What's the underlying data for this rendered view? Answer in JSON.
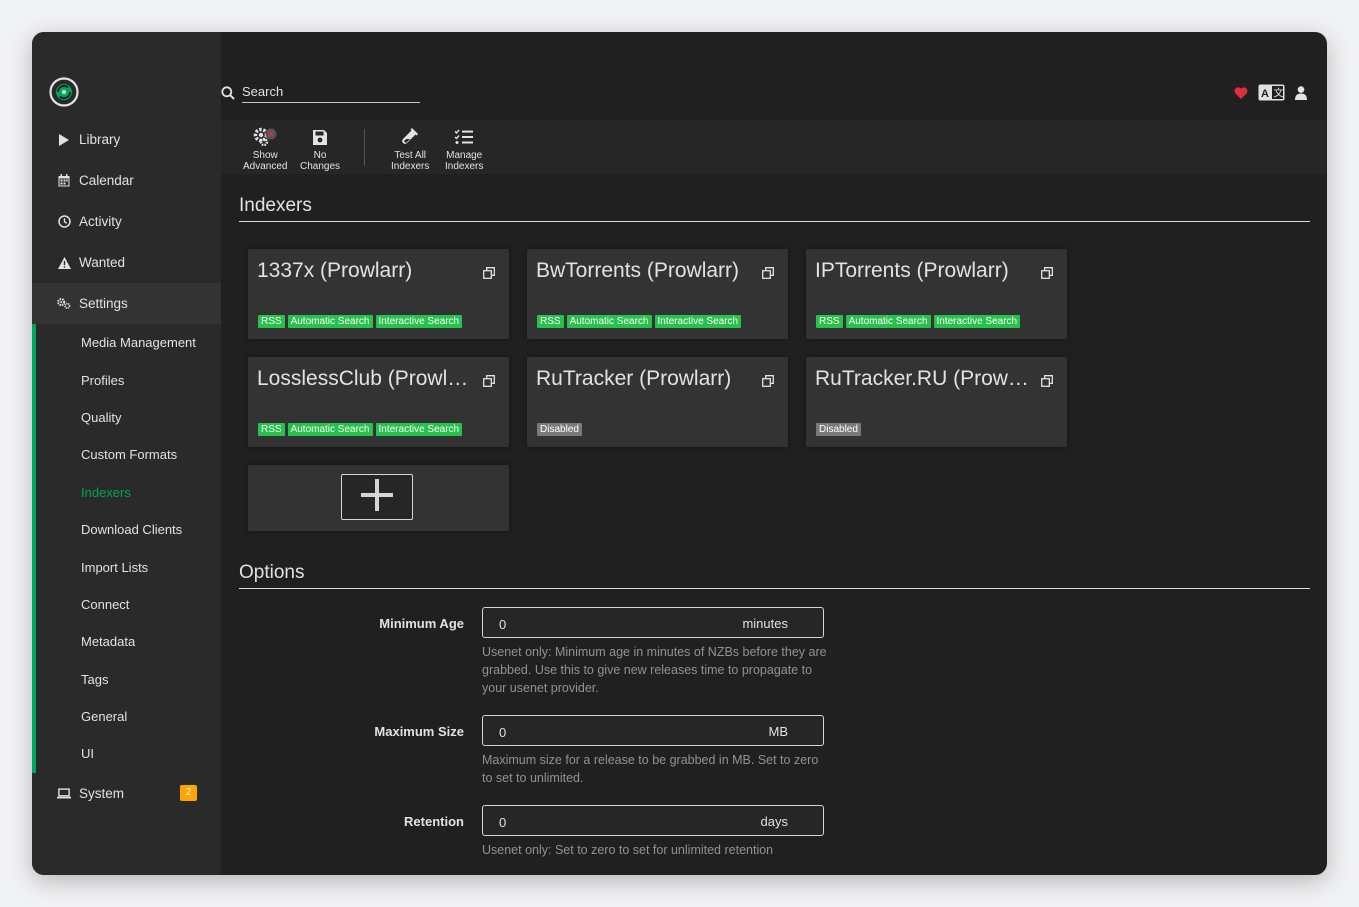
{
  "colors": {
    "accent": "#00a65b",
    "label_green": "#27c24c",
    "label_disabled": "#7a7a7a",
    "badge": "#ffa500",
    "heart": "#e22e3a"
  },
  "header": {
    "search_placeholder": "Search"
  },
  "sidebar": {
    "items": [
      {
        "label": "Library",
        "icon": "play-icon"
      },
      {
        "label": "Calendar",
        "icon": "calendar-icon"
      },
      {
        "label": "Activity",
        "icon": "clock-icon"
      },
      {
        "label": "Wanted",
        "icon": "warning-icon"
      },
      {
        "label": "Settings",
        "icon": "cogs-icon"
      },
      {
        "label": "System",
        "icon": "laptop-icon",
        "badge": "2"
      }
    ],
    "settings_items": [
      "Media Management",
      "Profiles",
      "Quality",
      "Custom Formats",
      "Indexers",
      "Download Clients",
      "Import Lists",
      "Connect",
      "Metadata",
      "Tags",
      "General",
      "UI"
    ]
  },
  "toolbar": {
    "show_advanced": [
      "Show",
      "Advanced"
    ],
    "no_changes": [
      "No",
      "Changes"
    ],
    "test_all": [
      "Test All",
      "Indexers"
    ],
    "manage": [
      "Manage",
      "Indexers"
    ]
  },
  "indexers": {
    "title": "Indexers",
    "cards": [
      {
        "name": "1337x (Prowlarr)",
        "labels": [
          "RSS",
          "Automatic Search",
          "Interactive Search"
        ]
      },
      {
        "name": "BwTorrents (Prowlarr)",
        "labels": [
          "RSS",
          "Automatic Search",
          "Interactive Search"
        ]
      },
      {
        "name": "IPTorrents (Prowlarr)",
        "labels": [
          "RSS",
          "Automatic Search",
          "Interactive Search"
        ]
      },
      {
        "name": "LosslessClub (Prowla...",
        "labels": [
          "RSS",
          "Automatic Search",
          "Interactive Search"
        ]
      },
      {
        "name": "RuTracker (Prowlarr)",
        "labels": [
          "Disabled"
        ]
      },
      {
        "name": "RuTracker.RU (Prowla...",
        "labels": [
          "Disabled"
        ]
      }
    ]
  },
  "options": {
    "title": "Options",
    "min_age": {
      "label": "Minimum Age",
      "value": "0",
      "unit": "minutes",
      "help": "Usenet only: Minimum age in minutes of NZBs before they are grabbed. Use this to give new releases time to propagate to your usenet provider."
    },
    "max_size": {
      "label": "Maximum Size",
      "value": "0",
      "unit": "MB",
      "help": "Maximum size for a release to be grabbed in MB. Set to zero to set to unlimited."
    },
    "retention": {
      "label": "Retention",
      "value": "0",
      "unit": "days",
      "help": "Usenet only: Set to zero to set for unlimited retention"
    }
  }
}
